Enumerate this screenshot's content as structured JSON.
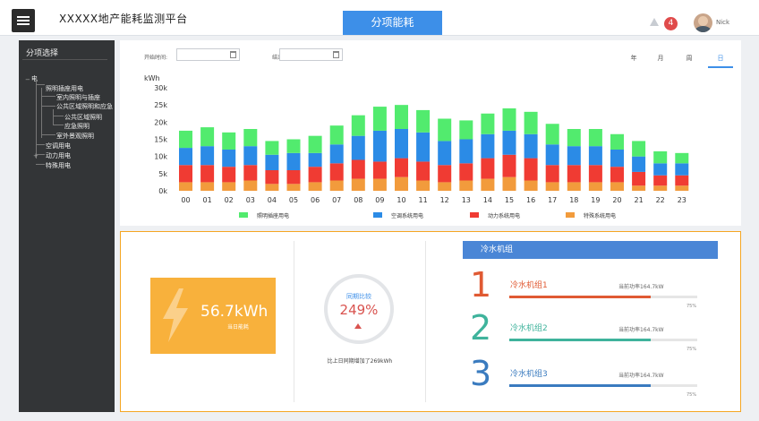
{
  "header": {
    "app_title": "XXXXX地产能耗监测平台",
    "active_tab": "分项能耗",
    "notification_count": "4",
    "user_name": "Nick"
  },
  "sidebar": {
    "title": "分项选择",
    "tree": [
      {
        "label": "电",
        "level": 0
      },
      {
        "label": "照明插座用电",
        "level": 1
      },
      {
        "label": "室内照明与插座",
        "level": 2
      },
      {
        "label": "公共区域照明和应急",
        "level": 2
      },
      {
        "label": "公共区域照明",
        "level": 3
      },
      {
        "label": "应急照明",
        "level": 3
      },
      {
        "label": "室外景观照明",
        "level": 2
      },
      {
        "label": "空调用电",
        "level": 1
      },
      {
        "label": "动力用电",
        "level": 1
      },
      {
        "label": "特殊用电",
        "level": 1
      }
    ]
  },
  "filters": {
    "start_label": "开始时间:",
    "end_label": "结束时间:",
    "start_value": "",
    "end_value": "",
    "periods": [
      "年",
      "月",
      "周",
      "日"
    ],
    "active_period": "日"
  },
  "chart_data": {
    "type": "bar",
    "stacked": true,
    "unit_label": "kWh",
    "categories": [
      "00",
      "01",
      "02",
      "03",
      "04",
      "05",
      "06",
      "07",
      "08",
      "09",
      "10",
      "11",
      "12",
      "13",
      "14",
      "15",
      "16",
      "17",
      "18",
      "19",
      "20",
      "21",
      "22",
      "23"
    ],
    "yticks": [
      "30k",
      "25k",
      "20k",
      "15k",
      "10k",
      "5k",
      "0k"
    ],
    "ylim": [
      0,
      30000
    ],
    "legend_position": "bottom",
    "series": [
      {
        "name": "特殊系统用电",
        "color": "#f29b3c",
        "values": [
          2500,
          2500,
          2500,
          3000,
          2000,
          2000,
          2500,
          3000,
          3500,
          3500,
          4000,
          3000,
          2500,
          3000,
          3500,
          4000,
          3000,
          2500,
          2500,
          2500,
          2500,
          1500,
          1500,
          1500
        ]
      },
      {
        "name": "动力系统用电",
        "color": "#f03b33",
        "values": [
          5000,
          5000,
          4500,
          4500,
          4000,
          4000,
          4500,
          5000,
          5500,
          5000,
          5500,
          5500,
          5000,
          5000,
          6000,
          6500,
          6500,
          5000,
          5000,
          5000,
          4500,
          4000,
          3000,
          3000
        ]
      },
      {
        "name": "空调系统用电",
        "color": "#2b8be6",
        "values": [
          5000,
          5500,
          5000,
          5500,
          4500,
          5000,
          4000,
          5500,
          7000,
          9000,
          8500,
          8500,
          7000,
          7000,
          7000,
          7000,
          7000,
          6000,
          5500,
          5500,
          5000,
          4500,
          3500,
          3500
        ]
      },
      {
        "name": "照明插座用电",
        "color": "#52eb6e",
        "values": [
          5000,
          5500,
          5000,
          5000,
          4000,
          4000,
          5000,
          5500,
          6000,
          7000,
          7000,
          6500,
          6500,
          5500,
          6000,
          6500,
          6500,
          6000,
          5000,
          5000,
          4500,
          4500,
          3500,
          3000
        ]
      }
    ]
  },
  "summary": {
    "energy_value": "56.7kWh",
    "energy_label": "当日能耗",
    "compare_label": "同期比较",
    "compare_value": "249%",
    "compare_direction": "up",
    "compare_note": "比上日同期增加了269kWh"
  },
  "units": {
    "title": "冷水机组",
    "items": [
      {
        "number": "1",
        "name": "冷水机组1",
        "power": "当前功率164.7kW",
        "percent": "75%",
        "fill_fraction": 0.75,
        "color": "#e05a33"
      },
      {
        "number": "2",
        "name": "冷水机组2",
        "power": "当前功率164.7kW",
        "percent": "75%",
        "fill_fraction": 0.75,
        "color": "#3fb39c"
      },
      {
        "number": "3",
        "name": "冷水机组3",
        "power": "当前功率164.7kW",
        "percent": "75%",
        "fill_fraction": 0.75,
        "color": "#3a7bbf"
      }
    ]
  }
}
